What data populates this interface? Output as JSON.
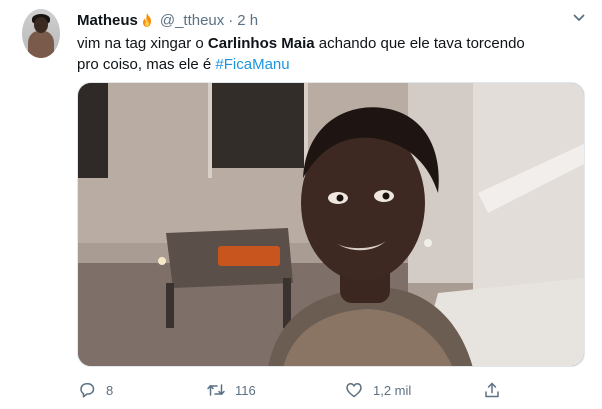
{
  "author": {
    "display_name": "Matheus",
    "handle": "@_ttheux",
    "separator": "·",
    "time": "2 h"
  },
  "text": {
    "part1": "vim na tag  xingar o ",
    "bold": "Carlinhos Maia",
    "part2": " achando que ele tava torcendo pro coiso, mas ele é ",
    "hashtag": "#FicaManu"
  },
  "actions": {
    "reply_count": "8",
    "retweet_count": "116",
    "like_count": "1,2 mil"
  },
  "icons": {
    "menu": "chevron-down-icon",
    "name_badge": "fire-icon",
    "reply": "reply-icon",
    "retweet": "retweet-icon",
    "like": "heart-icon",
    "share": "share-icon"
  },
  "colors": {
    "secondary_text": "#5b7083",
    "hashtag": "#1b95e0"
  }
}
